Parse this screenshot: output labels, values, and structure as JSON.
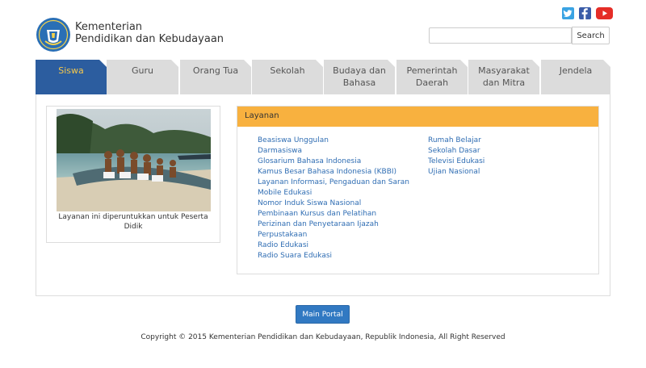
{
  "header": {
    "ministry_line1": "Kementerian",
    "ministry_line2": "Pendidikan dan Kebudayaan",
    "search_button": "Search",
    "search_placeholder": ""
  },
  "social": {
    "twitter": "twitter-icon",
    "facebook": "facebook-icon",
    "youtube": "youtube-icon"
  },
  "tabs": [
    {
      "line1": "Siswa",
      "line2": ""
    },
    {
      "line1": "Guru",
      "line2": ""
    },
    {
      "line1": "Orang Tua",
      "line2": ""
    },
    {
      "line1": "Sekolah",
      "line2": ""
    },
    {
      "line1": "Budaya dan",
      "line2": "Bahasa"
    },
    {
      "line1": "Pemerintah",
      "line2": "Daerah"
    },
    {
      "line1": "Masyarakat",
      "line2": "dan Mitra"
    },
    {
      "line1": "Jendela",
      "line2": ""
    }
  ],
  "photo": {
    "caption": "Layanan ini diperuntukkan untuk Peserta Didik"
  },
  "services": {
    "title": "Layanan",
    "left": [
      "Beasiswa Unggulan",
      "Darmasiswa",
      "Glosarium Bahasa Indonesia",
      "Kamus Besar Bahasa Indonesia (KBBI)",
      "Layanan Informasi, Pengaduan dan Saran",
      "Mobile Edukasi",
      "Nomor Induk Siswa Nasional",
      "Pembinaan Kursus dan Pelatihan",
      "Perizinan dan Penyetaraan Ijazah",
      "Perpustakaan",
      "Radio Edukasi",
      "Radio Suara Edukasi"
    ],
    "right": [
      "Rumah Belajar",
      "Sekolah Dasar",
      "Televisi Edukasi",
      "Ujian Nasional"
    ]
  },
  "footer": {
    "portal_button": "Main Portal",
    "copyright": "Copyright © 2015 Kementerian Pendidikan dan Kebudayaan, Republik Indonesia, All Right Reserved"
  },
  "colors": {
    "active_tab": "#2c5d9f",
    "active_tab_text": "#f5c84c",
    "services_header": "#f8b13f",
    "link": "#2f6db3",
    "portal_button": "#3179c2"
  }
}
